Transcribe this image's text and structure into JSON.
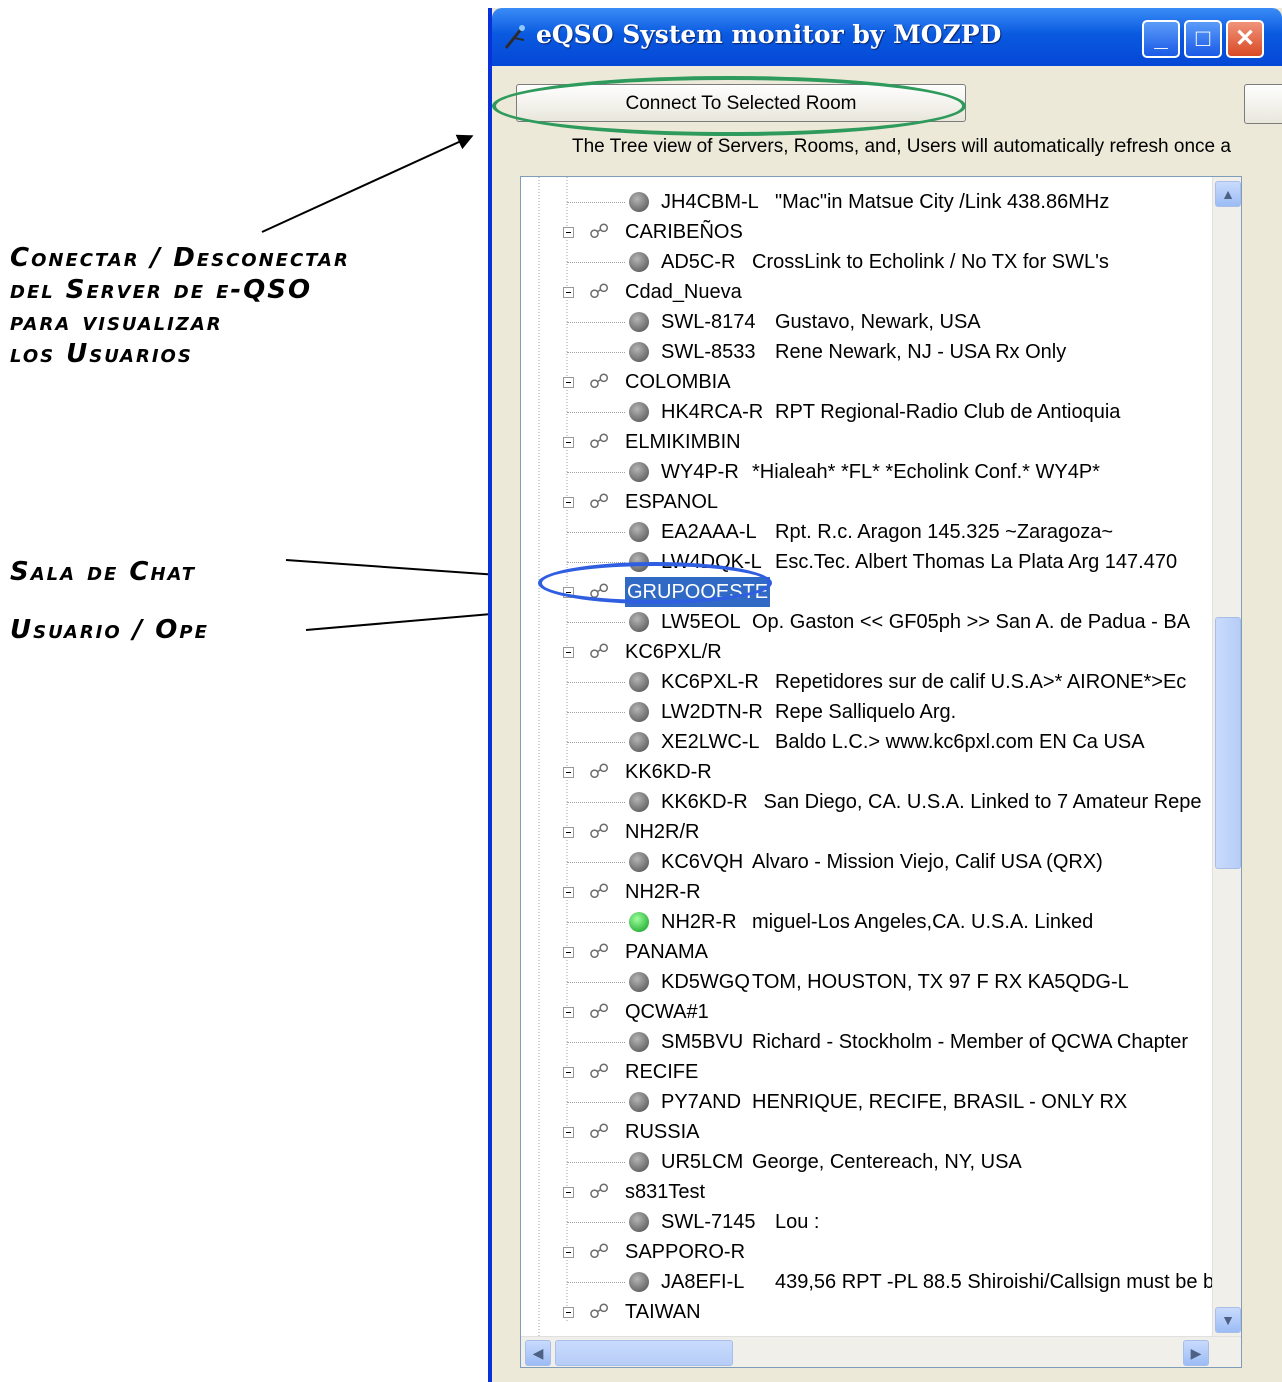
{
  "annotations": {
    "connect": [
      "Conectar / Desconectar",
      "del Server de e-QSO",
      "para visualizar",
      "los Usuarios"
    ],
    "chat_room": "Sala de Chat",
    "user": "Usuario / Ope"
  },
  "window": {
    "title": "eQSO System monitor by MOZPD",
    "minimize_icon": "minimize-icon",
    "maximize_icon": "maximize-icon",
    "close_icon": "close-icon"
  },
  "toolbar": {
    "connect_label": "Connect To Selected Room"
  },
  "info_text": "The Tree view of Servers, Rooms, and, Users will automatically refresh once a",
  "tree": [
    {
      "type": "user",
      "call": "JH4CBM-L",
      "desc": "\"Mac\"in Matsue City /Link 438.86MHz"
    },
    {
      "type": "room",
      "name": "CARIBEÑOS"
    },
    {
      "type": "user",
      "call": "AD5C-R",
      "desc": "CrossLink to Echolink / No TX for SWL's"
    },
    {
      "type": "room",
      "name": "Cdad_Nueva"
    },
    {
      "type": "user",
      "call": "SWL-8174",
      "desc": "Gustavo, Newark, USA"
    },
    {
      "type": "user",
      "call": "SWL-8533",
      "desc": "Rene  Newark, NJ - USA   Rx  Only"
    },
    {
      "type": "room",
      "name": "COLOMBIA"
    },
    {
      "type": "user",
      "call": "HK4RCA-R",
      "desc": "RPT Regional-Radio Club de Antioquia"
    },
    {
      "type": "room",
      "name": "ELMIKIMBIN"
    },
    {
      "type": "user",
      "call": "WY4P-R",
      "desc": "*Hialeah* *FL* *Echolink Conf.* WY4P*"
    },
    {
      "type": "room",
      "name": "ESPANOL"
    },
    {
      "type": "user",
      "call": "EA2AAA-L",
      "desc": "Rpt. R.c.  Aragon  145.325  ~Zaragoza~"
    },
    {
      "type": "user",
      "call": "LW4DQK-L",
      "desc": "Esc.Tec. Albert Thomas La Plata Arg 147.470"
    },
    {
      "type": "room",
      "name": "GRUPOOESTE",
      "selected": true
    },
    {
      "type": "user",
      "call": "LW5EOL",
      "desc": "Op. Gaston << GF05ph >> San A. de Padua - BA"
    },
    {
      "type": "room",
      "name": "KC6PXL/R"
    },
    {
      "type": "user",
      "call": "KC6PXL-R",
      "desc": "Repetidores  sur de calif U.S.A>* AIRONE*>Ec"
    },
    {
      "type": "user",
      "call": "LW2DTN-R",
      "desc": "Repe Salliquelo Arg."
    },
    {
      "type": "user",
      "call": "XE2LWC-L",
      "desc": "Baldo  L.C.>     www.kc6pxl.com   EN Ca USA"
    },
    {
      "type": "room",
      "name": "KK6KD-R"
    },
    {
      "type": "user",
      "call": "KK6KD-R",
      "desc": "San Diego, CA. U.S.A. Linked to 7 Amateur Repe"
    },
    {
      "type": "room",
      "name": "NH2R/R"
    },
    {
      "type": "user",
      "call": "KC6VQH",
      "desc": "Alvaro - Mission Viejo, Calif USA (QRX)"
    },
    {
      "type": "room",
      "name": "NH2R-R"
    },
    {
      "type": "user",
      "call": "NH2R-R",
      "desc": "miguel-Los Angeles,CA. U.S.A. Linked",
      "active": true
    },
    {
      "type": "room",
      "name": "PANAMA"
    },
    {
      "type": "user",
      "call": "KD5WGQ",
      "desc": "TOM, HOUSTON, TX 97 F RX  KA5QDG-L"
    },
    {
      "type": "room",
      "name": "QCWA#1"
    },
    {
      "type": "user",
      "call": "SM5BVU",
      "desc": "Richard - Stockholm - Member of QCWA Chapter"
    },
    {
      "type": "room",
      "name": "RECIFE"
    },
    {
      "type": "user",
      "call": "PY7AND",
      "desc": "HENRIQUE, RECIFE, BRASIL  -  ONLY RX"
    },
    {
      "type": "room",
      "name": "RUSSIA"
    },
    {
      "type": "user",
      "call": "UR5LCM",
      "desc": "George, Centereach, NY, USA"
    },
    {
      "type": "room",
      "name": "s831Test"
    },
    {
      "type": "user",
      "call": "SWL-7145",
      "desc": "Lou :"
    },
    {
      "type": "room",
      "name": "SAPPORO-R"
    },
    {
      "type": "user",
      "call": "JA8EFI-L",
      "desc": "439,56 RPT -PL 88.5 Shiroishi/Callsign must be b"
    },
    {
      "type": "room",
      "name": "TAIWAN"
    }
  ],
  "colors": {
    "accent_green": "#2e9a5b",
    "accent_blue": "#2f5fe0",
    "selection": "#316ac5"
  }
}
